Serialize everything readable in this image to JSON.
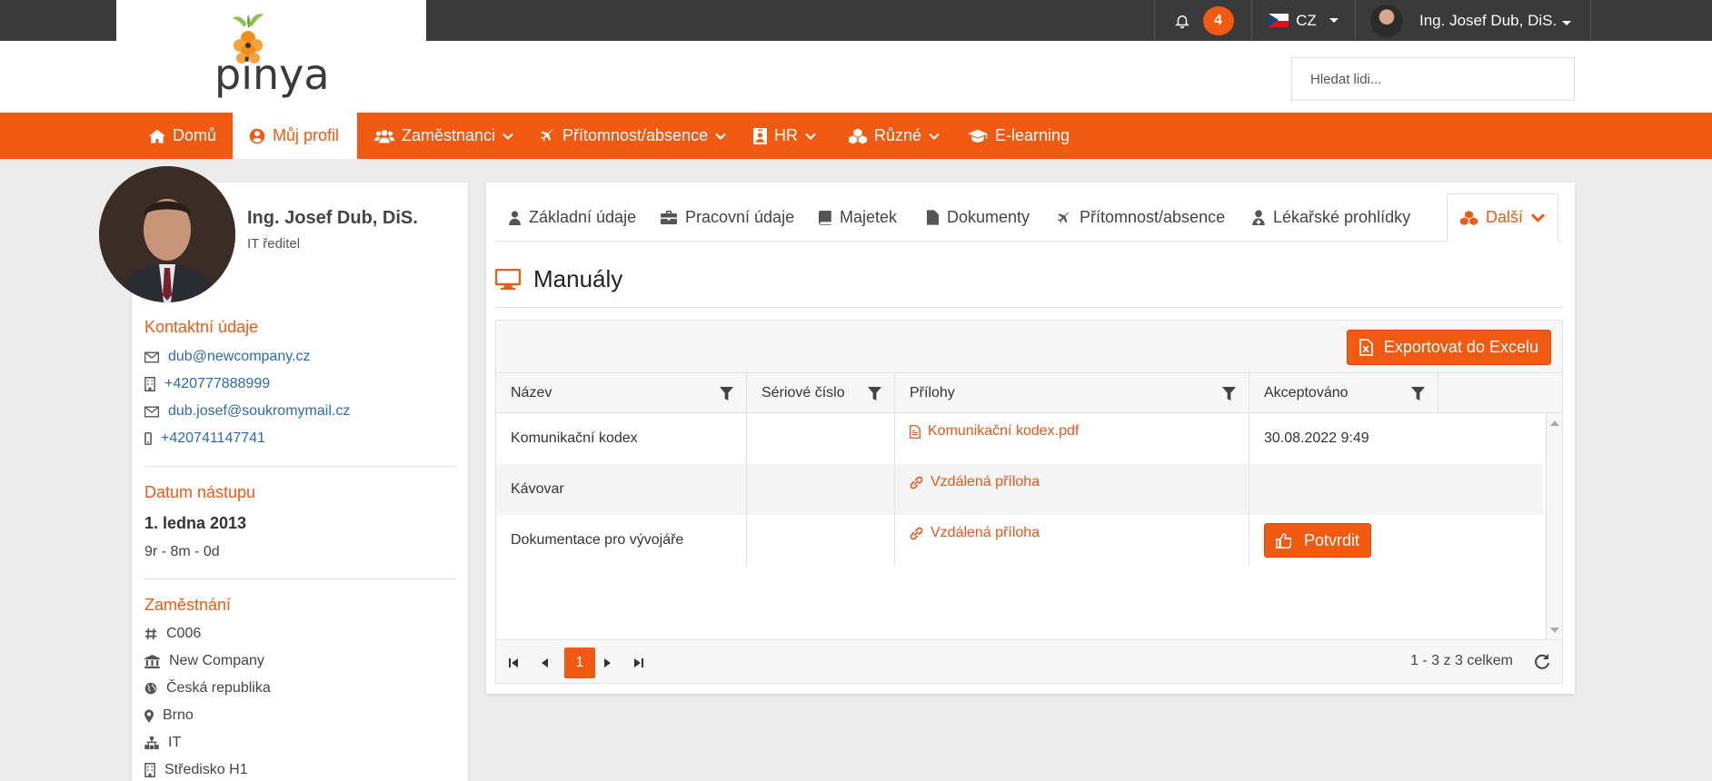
{
  "app": {
    "brand": "pinya",
    "notifications_count": "4",
    "language": "CZ",
    "user_name": "Ing. Josef Dub, DiS.",
    "search_placeholder": "Hledat lidi..."
  },
  "nav": {
    "items": [
      {
        "label": "Domů",
        "icon": "home-icon"
      },
      {
        "label": "Můj profil",
        "icon": "user-circle-icon"
      },
      {
        "label": "Zaměstnanci",
        "icon": "users-icon"
      },
      {
        "label": "Přítomnost/absence",
        "icon": "plane-icon"
      },
      {
        "label": "HR",
        "icon": "id-badge-icon"
      },
      {
        "label": "Různé",
        "icon": "cubes-icon"
      },
      {
        "label": "E-learning",
        "icon": "graduation-cap-icon"
      }
    ]
  },
  "profile": {
    "name": "Ing. Josef Dub, DiS.",
    "role": "IT ředitel",
    "contact_title": "Kontaktní údaje",
    "contacts": [
      {
        "value": "dub@newcompany.cz",
        "icon": "envelope-icon"
      },
      {
        "value": "+420777888999",
        "icon": "building-phone-icon"
      },
      {
        "value": "dub.josef@soukromymail.cz",
        "icon": "envelope-icon"
      },
      {
        "value": "+420741147741",
        "icon": "mobile-icon"
      }
    ],
    "start_title": "Datum nástupu",
    "start_date": "1. ledna 2013",
    "tenure": "9r - 8m - 0d",
    "employment_title": "Zaměstnání",
    "employment": [
      {
        "value": "C006",
        "icon": "hash-icon"
      },
      {
        "value": "New Company",
        "icon": "bank-icon"
      },
      {
        "value": "Česká republika",
        "icon": "globe-icon"
      },
      {
        "value": "Brno",
        "icon": "map-marker-icon"
      },
      {
        "value": "IT",
        "icon": "sitemap-icon"
      },
      {
        "value": "Středisko H1",
        "icon": "building-icon"
      }
    ]
  },
  "tabs": [
    {
      "label": "Základní údaje",
      "icon": "user-icon"
    },
    {
      "label": "Pracovní údaje",
      "icon": "briefcase-icon"
    },
    {
      "label": "Majetek",
      "icon": "book-icon"
    },
    {
      "label": "Dokumenty",
      "icon": "file-icon"
    },
    {
      "label": "Přítomnost/absence",
      "icon": "plane-icon"
    },
    {
      "label": "Lékařské prohlídky",
      "icon": "user-md-icon"
    },
    {
      "label": "Další",
      "icon": "cubes-icon"
    }
  ],
  "section": {
    "title": "Manuály",
    "export_label": "Exportovat do Excelu"
  },
  "table": {
    "columns": [
      "Název",
      "Sériové číslo",
      "Přílohy",
      "Akceptováno"
    ],
    "rows": [
      {
        "name": "Komunikační kodex",
        "serial": "",
        "attachment": "Komunikační kodex.pdf",
        "attachment_icon": "file-pdf-icon",
        "accepted": "30.08.2022 9:49"
      },
      {
        "name": "Kávovar",
        "serial": "",
        "attachment": "Vzdálená příloha",
        "attachment_icon": "link-icon",
        "accepted": ""
      },
      {
        "name": "Dokumentace pro vývojáře",
        "serial": "",
        "attachment": "Vzdálená příloha",
        "attachment_icon": "link-icon",
        "accepted": "",
        "action": "Potvrdit"
      }
    ]
  },
  "pager": {
    "current_page": "1",
    "info": "1 - 3 z 3 celkem"
  },
  "colors": {
    "accent": "#f25a12",
    "topbar": "#3a3a3a",
    "link": "#2a6bb1"
  }
}
